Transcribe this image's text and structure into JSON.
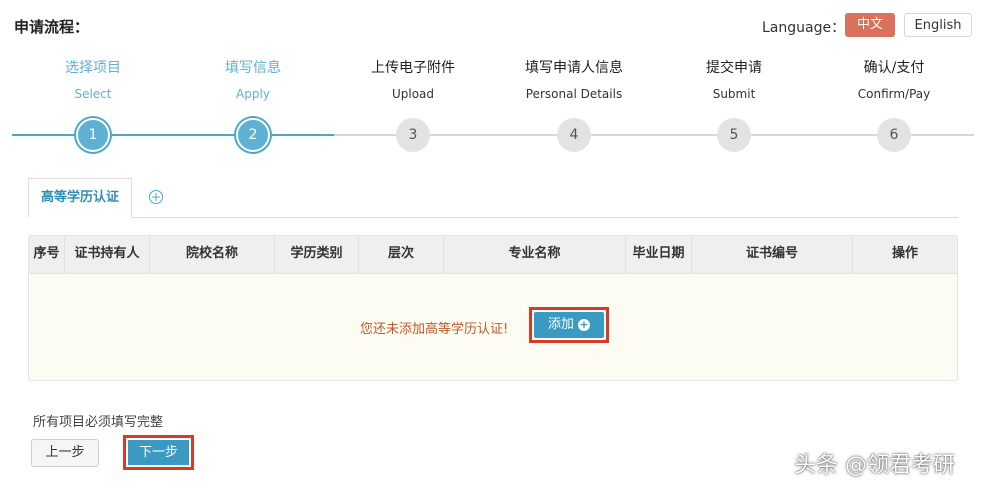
{
  "header": {
    "title": "申请流程：",
    "language_label": "Language：",
    "lang_zh": "中文",
    "lang_en": "English"
  },
  "steps": [
    {
      "cn": "选择项目",
      "en": "Select",
      "num": "1",
      "state": "done"
    },
    {
      "cn": "填写信息",
      "en": "Apply",
      "num": "2",
      "state": "current"
    },
    {
      "cn": "上传电子附件",
      "en": "Upload",
      "num": "3",
      "state": "todo"
    },
    {
      "cn": "填写申请人信息",
      "en": "Personal Details",
      "num": "4",
      "state": "todo"
    },
    {
      "cn": "提交申请",
      "en": "Submit",
      "num": "5",
      "state": "todo"
    },
    {
      "cn": "确认/支付",
      "en": "Confirm/Pay",
      "num": "6",
      "state": "todo"
    }
  ],
  "tabs": {
    "active": "高等学历认证",
    "add_icon": "plus-circle-icon"
  },
  "table": {
    "columns": [
      "序号",
      "证书持有人",
      "院校名称",
      "学历类别",
      "层次",
      "专业名称",
      "毕业日期",
      "证书编号",
      "操作"
    ],
    "empty_message": "您还未添加高等学历认证!",
    "add_label": "添加"
  },
  "footer": {
    "note": "所有项目必须填写完整",
    "prev_label": "上一步",
    "next_label": "下一步"
  },
  "watermark": "头条 @领君考研",
  "colors": {
    "accent": "#3a9ac2",
    "step_done": "#5fb1d4",
    "lang_active": "#d9725c",
    "highlight_frame": "#d63a2b",
    "warning_text": "#c0592b"
  }
}
